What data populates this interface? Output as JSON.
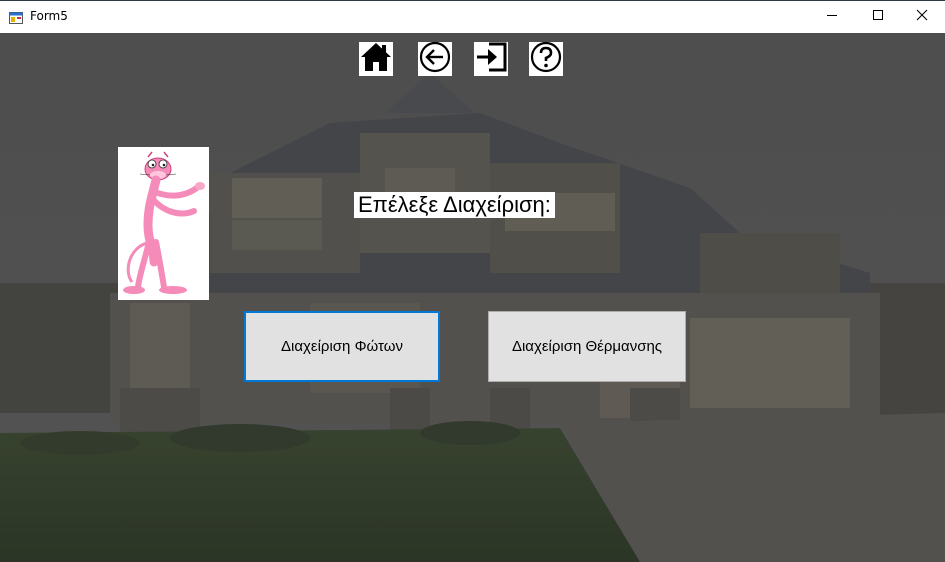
{
  "window": {
    "title": "Form5",
    "app_icon": "form-app-icon",
    "controls": [
      "minimize-icon",
      "maximize-icon",
      "close-icon"
    ]
  },
  "toolbar": {
    "icons": [
      "home-icon",
      "back-arrow-icon",
      "exit-icon",
      "help-icon"
    ]
  },
  "mascot": {
    "icon": "pink-panther-image"
  },
  "main": {
    "prompt": "Επέλεξε Διαχείριση:",
    "buttons": {
      "lights": "Διαχείριση Φώτων",
      "heating": "Διαχείριση Θέρμανσης"
    }
  },
  "colors": {
    "focus_border": "#0078d7",
    "button_face": "#e1e1e1",
    "background_overlay": "#555555"
  }
}
